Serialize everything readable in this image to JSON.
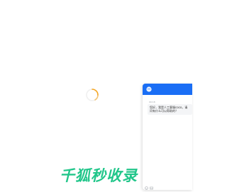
{
  "loading": {
    "icon": "spinner-icon",
    "accent": "#f5a623"
  },
  "chat": {
    "header_color": "#1a6ef5",
    "header_icon": "bot-avatar-icon",
    "timestamp": "09:18",
    "message": "您好，我是人工客服coco，请问有什么可以帮助的？"
  },
  "brand": {
    "text": "千狐秒收录",
    "color": "#21c68a"
  },
  "input_tools": {
    "icons": [
      "emoji-icon",
      "image-icon"
    ]
  }
}
